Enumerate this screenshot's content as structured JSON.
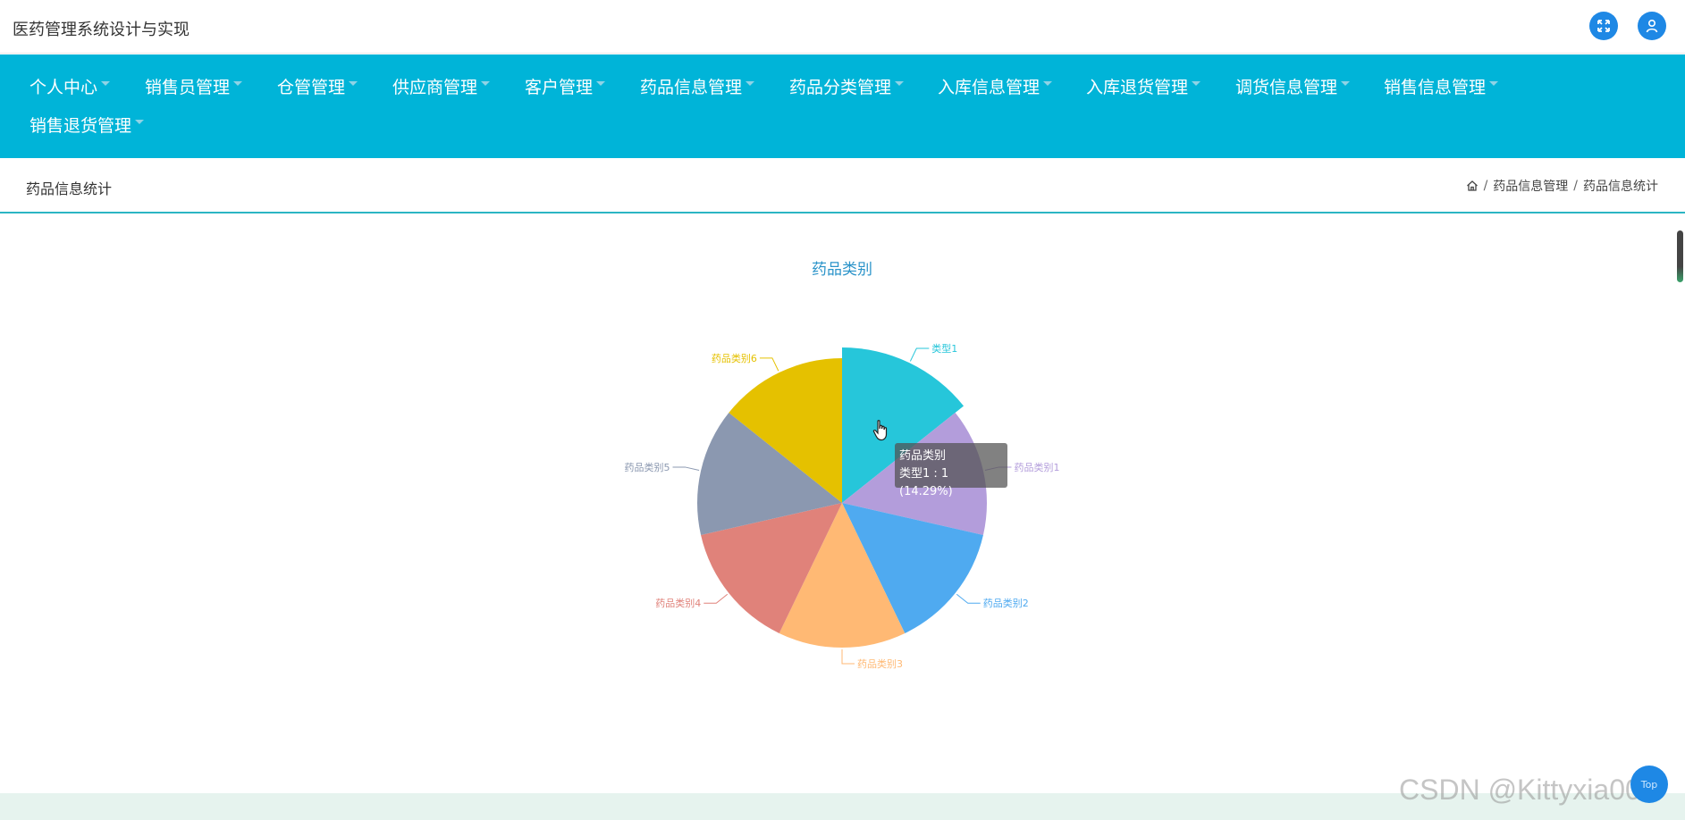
{
  "header": {
    "app_title": "医药管理系统设计与实现"
  },
  "icons": {
    "fullscreen": "expand-icon",
    "user": "user-icon",
    "home": "home-icon",
    "back_top": "back-to-top-icon"
  },
  "nav": {
    "items": [
      {
        "label": "个人中心"
      },
      {
        "label": "销售员管理"
      },
      {
        "label": "仓管管理"
      },
      {
        "label": "供应商管理"
      },
      {
        "label": "客户管理"
      },
      {
        "label": "药品信息管理"
      },
      {
        "label": "药品分类管理"
      },
      {
        "label": "入库信息管理"
      },
      {
        "label": "入库退货管理"
      },
      {
        "label": "调货信息管理"
      },
      {
        "label": "销售信息管理"
      },
      {
        "label": "销售退货管理"
      }
    ]
  },
  "page": {
    "title": "药品信息统计",
    "breadcrumb": [
      "药品信息管理",
      "药品信息统计"
    ]
  },
  "tooltip": {
    "title": "药品类别",
    "line": "类型1 : 1 (14.29%)"
  },
  "back_top_label": "Top",
  "watermark": "CSDN @Kittyxia001",
  "colors": {
    "nav_bg": "#00b4d8",
    "accent": "#1e88e5",
    "slices": [
      "#26c6da",
      "#b39ddb",
      "#4faaf0",
      "#ffb974",
      "#e0827a",
      "#8b98b0",
      "#e5c100"
    ]
  },
  "chart_data": {
    "type": "pie",
    "title": "药品类别",
    "categories": [
      "类型1",
      "药品类别1",
      "药品类别2",
      "药品类别3",
      "药品类别4",
      "药品类别5",
      "药品类别6"
    ],
    "values": [
      1,
      1,
      1,
      1,
      1,
      1,
      1
    ],
    "highlighted": "类型1"
  }
}
